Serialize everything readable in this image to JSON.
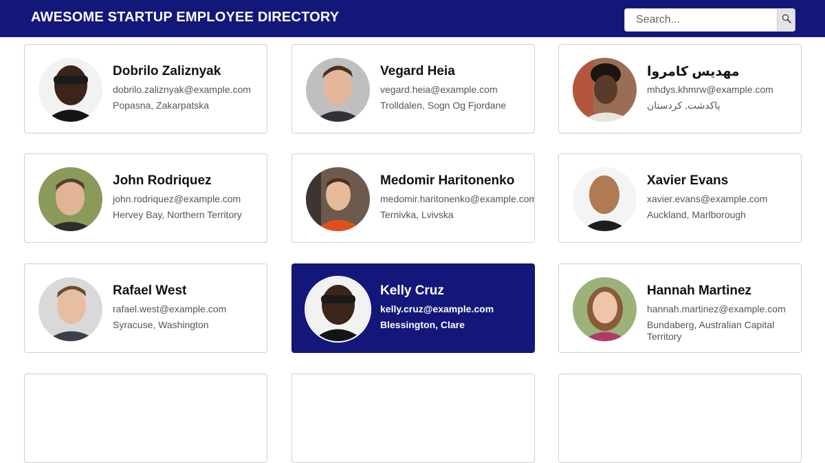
{
  "header": {
    "title": "AWESOME STARTUP EMPLOYEE DIRECTORY",
    "search_placeholder": "Search...",
    "search_icon": "magnifier-icon"
  },
  "colors": {
    "header_bg": "#14177a",
    "selected_card_bg": "#14177a"
  },
  "employees": [
    {
      "name": "Dobrilo Zaliznyak",
      "email": "dobrilo.zaliznyak@example.com",
      "location": "Popasna, Zakarpatska",
      "selected": false
    },
    {
      "name": "Vegard Heia",
      "email": "vegard.heia@example.com",
      "location": "Trolldalen, Sogn Og Fjordane",
      "selected": false
    },
    {
      "name": "مهدیس کامروا",
      "email": "mhdys.khmrw@example.com",
      "location": "پاکدشت, کردستان",
      "selected": false
    },
    {
      "name": "John Rodriquez",
      "email": "john.rodriquez@example.com",
      "location": "Hervey Bay, Northern Territory",
      "selected": false
    },
    {
      "name": "Medomir Haritonenko",
      "email": "medomir.haritonenko@example.com",
      "location": "Ternivka, Lvivska",
      "selected": false
    },
    {
      "name": "Xavier Evans",
      "email": "xavier.evans@example.com",
      "location": "Auckland, Marlborough",
      "selected": false
    },
    {
      "name": "Rafael West",
      "email": "rafael.west@example.com",
      "location": "Syracuse, Washington",
      "selected": false
    },
    {
      "name": "Kelly Cruz",
      "email": "kelly.cruz@example.com",
      "location": "Blessington, Clare",
      "selected": true
    },
    {
      "name": "Hannah Martinez",
      "email": "hannah.martinez@example.com",
      "location": "Bundaberg, Australian Capital Territory",
      "selected": false
    }
  ]
}
